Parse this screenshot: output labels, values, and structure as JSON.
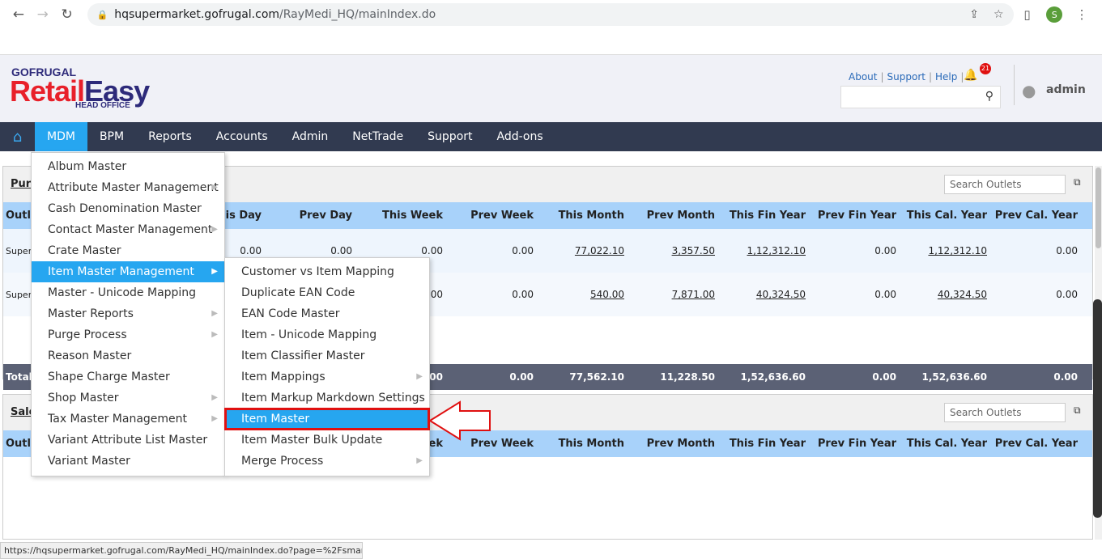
{
  "browser": {
    "url_host": "hqsupermarket.gofrugal.com",
    "url_path": "/RayMedi_HQ/mainIndex.do",
    "profile_initial": "S",
    "status_url": "https://hqsupermarket.gofrugal.com/RayMedi_HQ/mainIndex.do?page=%2Fsmart..."
  },
  "header": {
    "logo_top": "GOFRUGAL",
    "logo_red": "Retail",
    "logo_blue": "Easy",
    "logo_sub": "HEAD OFFICE",
    "links": [
      "About",
      "Support",
      "Help"
    ],
    "notification_count": "21",
    "user": "admin"
  },
  "menu": {
    "items": [
      "MDM",
      "BPM",
      "Reports",
      "Accounts",
      "Admin",
      "NetTrade",
      "Support",
      "Add-ons"
    ],
    "active": "MDM"
  },
  "mdm_menu": [
    {
      "label": "Album Master",
      "sub": false
    },
    {
      "label": "Attribute Master Management",
      "sub": true
    },
    {
      "label": "Cash Denomination Master",
      "sub": false
    },
    {
      "label": "Contact Master Management",
      "sub": true
    },
    {
      "label": "Crate Master",
      "sub": false
    },
    {
      "label": "Item Master Management",
      "sub": true
    },
    {
      "label": "Master - Unicode Mapping",
      "sub": false
    },
    {
      "label": "Master Reports",
      "sub": true
    },
    {
      "label": "Purge Process",
      "sub": true
    },
    {
      "label": "Reason Master",
      "sub": false
    },
    {
      "label": "Shape Charge Master",
      "sub": false
    },
    {
      "label": "Shop Master",
      "sub": true
    },
    {
      "label": "Tax Master Management",
      "sub": true
    },
    {
      "label": "Variant Attribute List Master",
      "sub": false
    },
    {
      "label": "Variant Master",
      "sub": false
    }
  ],
  "item_master_menu": [
    {
      "label": "Customer vs Item Mapping",
      "sub": false
    },
    {
      "label": "Duplicate EAN Code",
      "sub": false
    },
    {
      "label": "EAN Code Master",
      "sub": false
    },
    {
      "label": "Item - Unicode Mapping",
      "sub": false
    },
    {
      "label": "Item Classifier Master",
      "sub": false
    },
    {
      "label": "Item Mappings",
      "sub": true
    },
    {
      "label": "Item Markup Markdown Settings",
      "sub": false
    },
    {
      "label": "Item Master",
      "sub": false
    },
    {
      "label": "Item Master Bulk Update",
      "sub": false
    },
    {
      "label": "Merge Process",
      "sub": true
    }
  ],
  "purchase_panel": {
    "title": "Purc",
    "search_placeholder": "Search Outlets",
    "columns": [
      "Outle",
      "This Day",
      "Prev Day",
      "This Week",
      "Prev Week",
      "This Month",
      "Prev Month",
      "This Fin Year",
      "Prev Fin Year",
      "This Cal. Year",
      "Prev Cal. Year"
    ],
    "rows": [
      {
        "outlet": "Superr outlet1",
        "values": [
          "0.00",
          "0.00",
          "0.00",
          "0.00",
          "77,022.10",
          "3,357.50",
          "1,12,312.10",
          "0.00",
          "1,12,312.10",
          "0.00"
        ]
      },
      {
        "outlet": "Superr Wareh",
        "values": [
          "",
          "",
          ".00",
          "0.00",
          "540.00",
          "7,871.00",
          "40,324.50",
          "0.00",
          "40,324.50",
          "0.00"
        ]
      }
    ],
    "total": {
      "label": "Total",
      "values": [
        "",
        "",
        ".00",
        "0.00",
        "77,562.10",
        "11,228.50",
        "1,52,636.60",
        "0.00",
        "1,52,636.60",
        "0.00"
      ]
    }
  },
  "sales_panel": {
    "title": "Sale",
    "search_placeholder": "Search Outlets",
    "columns": [
      "Outle",
      "",
      "",
      "eek",
      "Prev Week",
      "This Month",
      "Prev Month",
      "This Fin Year",
      "Prev Fin Year",
      "This Cal. Year",
      "Prev Cal. Year"
    ]
  }
}
